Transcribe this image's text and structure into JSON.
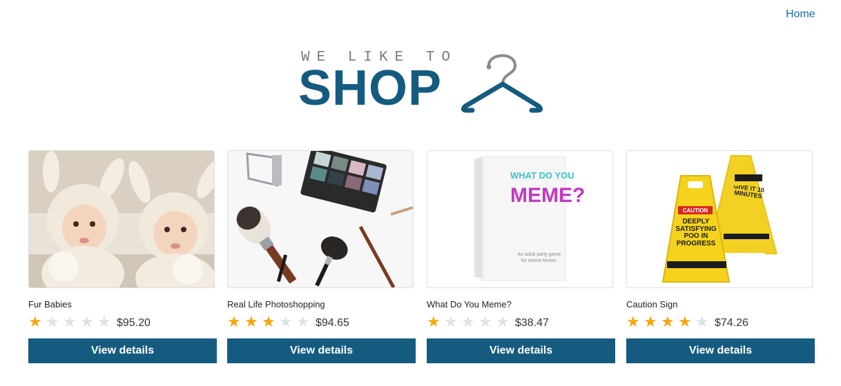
{
  "nav": {
    "home_label": "Home"
  },
  "logo": {
    "tagline": "WE LIKE TO",
    "word": "SHOP"
  },
  "colors": {
    "brand": "#155b80",
    "star_on": "#f5a70f",
    "star_off": "#dde2e7"
  },
  "products": [
    {
      "name": "Fur Babies",
      "rating": 1,
      "price": "$95.20",
      "button_label": "View details"
    },
    {
      "name": "Real Life Photoshopping",
      "rating": 3,
      "price": "$94.65",
      "button_label": "View details"
    },
    {
      "name": "What Do You Meme?",
      "rating": 1,
      "price": "$38.47",
      "button_label": "View details",
      "box_text": {
        "line1": "WHAT DO YOU",
        "line2": "MEME?",
        "caption": "An adult party game for meme-lovers."
      }
    },
    {
      "name": "Caution Sign",
      "rating": 4,
      "price": "$74.26",
      "button_label": "View details",
      "sign_text": {
        "caution": "CAUTION",
        "front": "DEEPLY SATISFYING POO IN PROGRESS",
        "back": "GIVE IT 10 MINUTES"
      }
    }
  ]
}
